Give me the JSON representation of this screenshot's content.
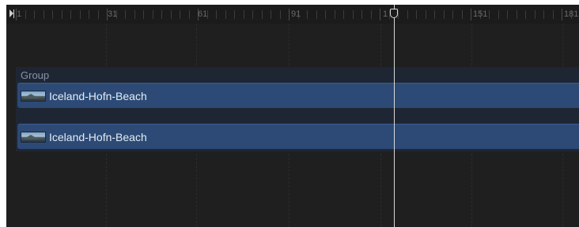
{
  "ruler": {
    "labels": [
      "1",
      "31",
      "61",
      "91",
      "1",
      "151",
      "181"
    ]
  },
  "timeline": {
    "group_label": "Group",
    "clips": [
      {
        "name": "Iceland-Hofn-Beach"
      },
      {
        "name": "Iceland-Hofn-Beach"
      }
    ]
  },
  "colors": {
    "background": "#1f1f1f",
    "clip": "#2c4a75",
    "group_band": "#1f2633",
    "playhead": "#d9d9d9"
  }
}
